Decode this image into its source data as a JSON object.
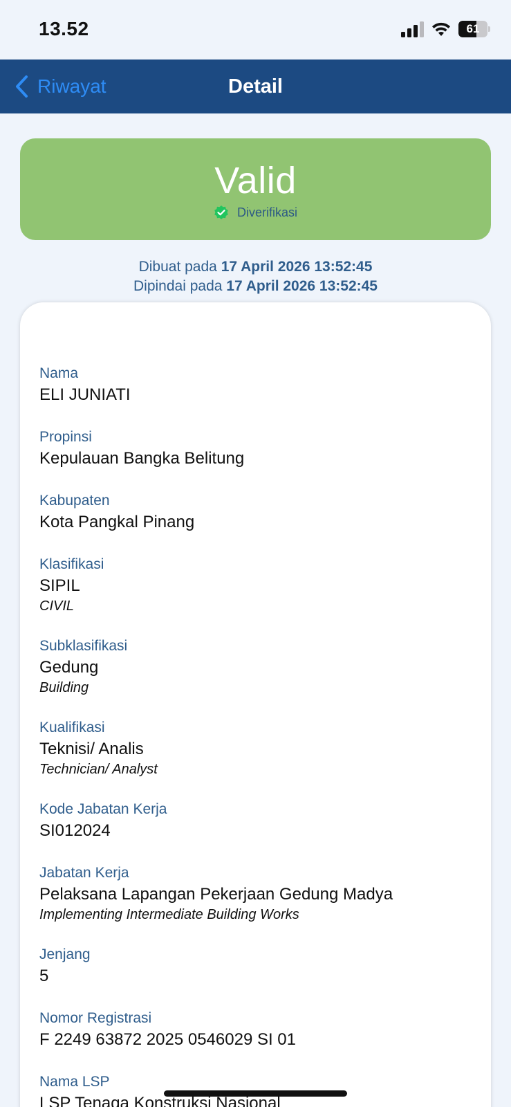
{
  "status_bar": {
    "time": "13.52",
    "battery": "61",
    "battery_level": 0.61
  },
  "nav": {
    "back_label": "Riwayat",
    "title": "Detail"
  },
  "banner": {
    "status": "Valid",
    "verified_label": "Diverifikasi",
    "color": "#91c472"
  },
  "timestamps": {
    "created_prefix": "Dibuat pada",
    "created_value": "17 April 2026 13:52:45",
    "scanned_prefix": "Dipindai pada",
    "scanned_value": "17 April 2026 13:52:45"
  },
  "fields": [
    {
      "label": "Nama",
      "value": "ELI JUNIATI"
    },
    {
      "label": "Propinsi",
      "value": "Kepulauan Bangka Belitung"
    },
    {
      "label": "Kabupaten",
      "value": "Kota Pangkal Pinang"
    },
    {
      "label": "Klasifikasi",
      "value": "SIPIL",
      "en": "CIVIL"
    },
    {
      "label": "Subklasifikasi",
      "value": "Gedung",
      "en": "Building"
    },
    {
      "label": "Kualifikasi",
      "value": "Teknisi/ Analis",
      "en": "Technician/ Analyst"
    },
    {
      "label": "Kode Jabatan Kerja",
      "value": "SI012024"
    },
    {
      "label": "Jabatan Kerja",
      "value": "Pelaksana Lapangan Pekerjaan Gedung Madya",
      "en": "Implementing Intermediate Building Works"
    },
    {
      "label": "Jenjang",
      "value": "5"
    },
    {
      "label": "Nomor Registrasi",
      "value": "F 2249 63872 2025 0546029 SI 01"
    },
    {
      "label": "Nama LSP",
      "value": "LSP Tenaga Konstruksi Nasional"
    }
  ],
  "colors": {
    "nav_bg": "#1c4a82",
    "accent_link": "#2e8cf5",
    "label_blue": "#2f5d8c",
    "page_bg": "#eff4fb"
  },
  "icons": [
    "signal-icon",
    "wifi-icon",
    "battery-icon",
    "back-chevron-icon",
    "check-badge-icon"
  ]
}
